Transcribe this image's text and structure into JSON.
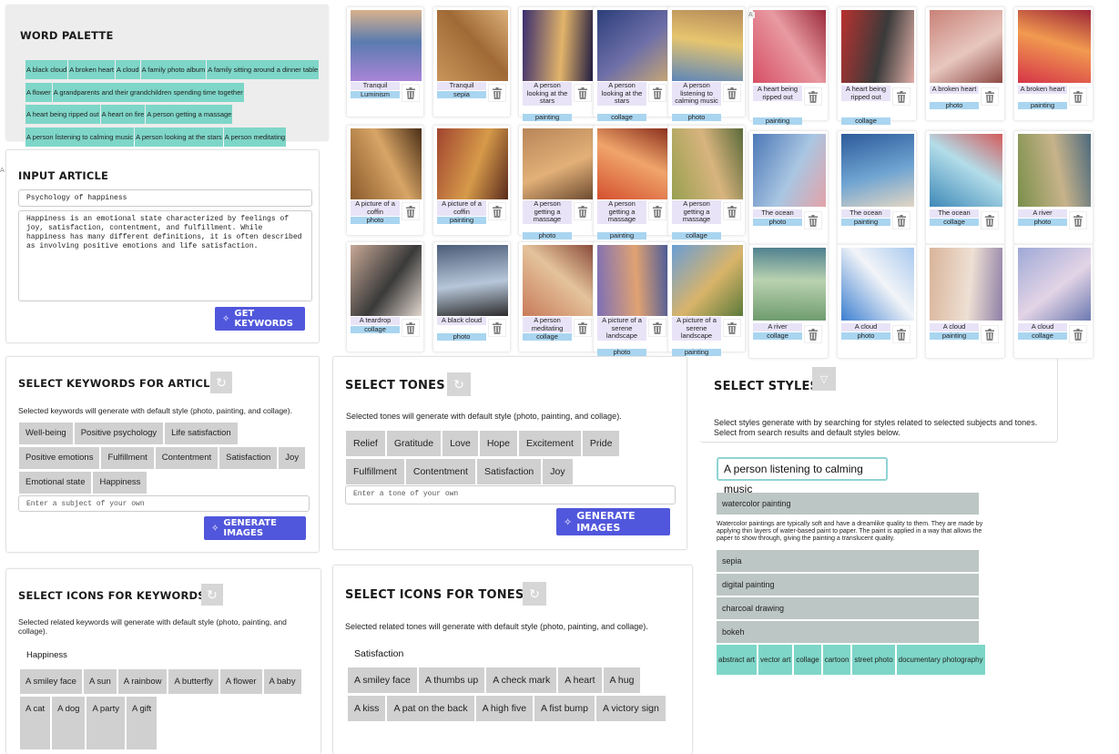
{
  "word_palette": {
    "title": "WORD PALETTE",
    "rows": [
      [
        "A black cloud",
        "A broken heart",
        "A cloud",
        "A family photo album",
        "A family sitting around a dinner table"
      ],
      [
        "A flower",
        "A grandparents and their grandchildren spending time together"
      ],
      [
        "A heart being ripped out",
        "A heart on fire",
        "A person getting a massage"
      ],
      [
        "A person listening to calming music",
        "A person looking at the stars",
        "A person meditating"
      ]
    ]
  },
  "input_article": {
    "title": "INPUT ARTICLE",
    "article_title": "Psychology of happiness",
    "article_body": "Happiness is an emotional state characterized by feelings of joy, satisfaction, contentment, and fulfillment. While happiness has many different definitions, it is often described as involving positive emotions and life satisfaction.",
    "button": "GET KEYWORDS"
  },
  "select_keywords": {
    "title": "SELECT KEYWORDS FOR ARTICLE",
    "description": "Selected keywords will generate with default style (photo, painting, and collage).",
    "rows": [
      [
        "Well-being",
        "Positive psychology",
        "Life satisfaction"
      ],
      [
        "Positive emotions",
        "Fulfillment",
        "Contentment",
        "Satisfaction",
        "Joy"
      ],
      [
        "Emotional state",
        "Happiness"
      ]
    ],
    "placeholder": "Enter a subject of your own",
    "button": "GENERATE IMAGES"
  },
  "select_tones": {
    "title": "SELECT TONES",
    "description": "Selected tones will generate with default style (photo, painting, and collage).",
    "rows": [
      [
        "Relief",
        "Gratitude",
        "Love",
        "Hope",
        "Excitement",
        "Pride"
      ],
      [
        "Fulfillment",
        "Contentment",
        "Satisfaction",
        "Joy"
      ]
    ],
    "placeholder": "Enter a tone of your own",
    "button": "GENERATE IMAGES"
  },
  "select_styles": {
    "title": "SELECT STYLES",
    "description": "Select styles generate with by searching for styles related to selected subjects and tones. Select from search results and default styles below.",
    "search_value": "A person listening to calming music",
    "first_style": "watercolor painting",
    "style_description": "Watercolor paintings are typically soft and have a dreamlike quality to them. They are made by applying thin layers of water-based paint to paper. The paint is applied in a way that allows the paper to show through, giving the painting a translucent quality.",
    "more_styles": [
      "sepia",
      "digital painting",
      "charcoal drawing",
      "bokeh"
    ],
    "default_styles": [
      "abstract art",
      "vector art",
      "collage",
      "cartoon",
      "street photo",
      "documentary photography"
    ]
  },
  "icons_keywords": {
    "title": "SELECT ICONS FOR KEYWORDS",
    "description": "Selected related keywords will generate with default style (photo, painting, and collage).",
    "subject": "Happiness",
    "rows": [
      [
        "A smiley face",
        "A sun",
        "A rainbow",
        "A butterfly",
        "A flower",
        "A baby"
      ],
      [
        "A cat",
        "A dog",
        "A party",
        "A gift"
      ]
    ]
  },
  "icons_tones": {
    "title": "SELECT ICONS FOR TONES",
    "description": "Selected related tones will generate with default style (photo, painting, and collage).",
    "subject": "Satisfaction",
    "rows": [
      [
        "A smiley face",
        "A thumbs up",
        "A check mark",
        "A heart",
        "A hug"
      ],
      [
        "A kiss",
        "A pat on the back",
        "A high five",
        "A fist bump",
        "A victory sign"
      ]
    ]
  },
  "images": [
    {
      "caption": "Tranquil",
      "tag": "Luminism",
      "palette": [
        "#a884d6",
        "#5a7bb0",
        "#d9b28c"
      ]
    },
    {
      "caption": "Tranquil",
      "tag": "sepia",
      "palette": [
        "#c9955b",
        "#a06a36",
        "#dcb07a"
      ]
    },
    {
      "caption": "A person looking at the stars",
      "tag": "painting",
      "palette": [
        "#3a2d6e",
        "#e2b46a",
        "#1b1840"
      ]
    },
    {
      "caption": "A person looking at the stars",
      "tag": "collage",
      "palette": [
        "#2c3f7a",
        "#6e6fa8",
        "#c5a676"
      ]
    },
    {
      "caption": "A person listening to calming music",
      "tag": "photo",
      "palette": [
        "#5d86b9",
        "#e6c56f",
        "#b58b5a"
      ]
    },
    {
      "caption": "A heart being ripped out",
      "tag": "painting",
      "palette": [
        "#d64f64",
        "#e89aa2",
        "#9b2b3c"
      ]
    },
    {
      "caption": "A heart being ripped out",
      "tag": "collage",
      "palette": [
        "#b8322f",
        "#3a3a3a",
        "#e0b0a8"
      ]
    },
    {
      "caption": "A broken heart",
      "tag": "photo",
      "palette": [
        "#c98278",
        "#e7c7bf",
        "#8e4a44"
      ]
    },
    {
      "caption": "A broken heart",
      "tag": "painting",
      "palette": [
        "#d63548",
        "#f19a50",
        "#9e2638"
      ]
    },
    {
      "caption": "A picture of a coffin",
      "tag": "photo",
      "palette": [
        "#8b5a2b",
        "#d7a566",
        "#4a2e17"
      ]
    },
    {
      "caption": "A picture of a coffin",
      "tag": "painting",
      "palette": [
        "#a1452f",
        "#d69a4a",
        "#5a2a1c"
      ]
    },
    {
      "caption": "A person getting a massage",
      "tag": "photo",
      "palette": [
        "#b88658",
        "#e2b078",
        "#6c4a30"
      ]
    },
    {
      "caption": "A person getting a massage",
      "tag": "painting",
      "palette": [
        "#d4502f",
        "#f0a56b",
        "#8a2f1d"
      ]
    },
    {
      "caption": "A person getting a massage",
      "tag": "collage",
      "palette": [
        "#99a050",
        "#d8b47e",
        "#5a6a3a"
      ]
    },
    {
      "caption": "The ocean",
      "tag": "photo",
      "palette": [
        "#4d78b7",
        "#a9c6e2",
        "#e4a2a8"
      ]
    },
    {
      "caption": "The ocean",
      "tag": "painting",
      "palette": [
        "#2d5a9a",
        "#6fa4d2",
        "#e3d6c4"
      ]
    },
    {
      "caption": "The ocean",
      "tag": "collage",
      "palette": [
        "#3e89b8",
        "#b3dde9",
        "#d35b5b"
      ]
    },
    {
      "caption": "A river",
      "tag": "photo",
      "palette": [
        "#7a8f4a",
        "#c7b38a",
        "#4d6a7d"
      ]
    },
    {
      "caption": "A teardrop",
      "tag": "collage",
      "palette": [
        "#c8a896",
        "#3a3a3a",
        "#e2d7ce"
      ]
    },
    {
      "caption": "A black cloud",
      "tag": "photo",
      "palette": [
        "#4b5c78",
        "#b7c6d9",
        "#2c2c2c"
      ]
    },
    {
      "caption": "A person meditating",
      "tag": "collage",
      "palette": [
        "#c87b5b",
        "#e4c39b",
        "#8a4a3a"
      ]
    },
    {
      "caption": "A picture of a serene landscape",
      "tag": "photo",
      "palette": [
        "#7d6fb6",
        "#e0a272",
        "#4a5a9a"
      ]
    },
    {
      "caption": "A picture of a serene landscape",
      "tag": "painting",
      "palette": [
        "#6a9ed6",
        "#d9b46a",
        "#5b7a3a"
      ]
    },
    {
      "caption": "A river",
      "tag": "collage",
      "palette": [
        "#6e9b6e",
        "#b9d2b0",
        "#4d7f8e"
      ]
    },
    {
      "caption": "A cloud",
      "tag": "photo",
      "palette": [
        "#3c7fd0",
        "#f2f4f8",
        "#a9c9ee"
      ]
    },
    {
      "caption": "A cloud",
      "tag": "painting",
      "palette": [
        "#d9b49a",
        "#eee0d4",
        "#8f7fa6"
      ]
    },
    {
      "caption": "A cloud",
      "tag": "collage",
      "palette": [
        "#9ea9d6",
        "#e3d4e6",
        "#6c79b0"
      ]
    }
  ]
}
